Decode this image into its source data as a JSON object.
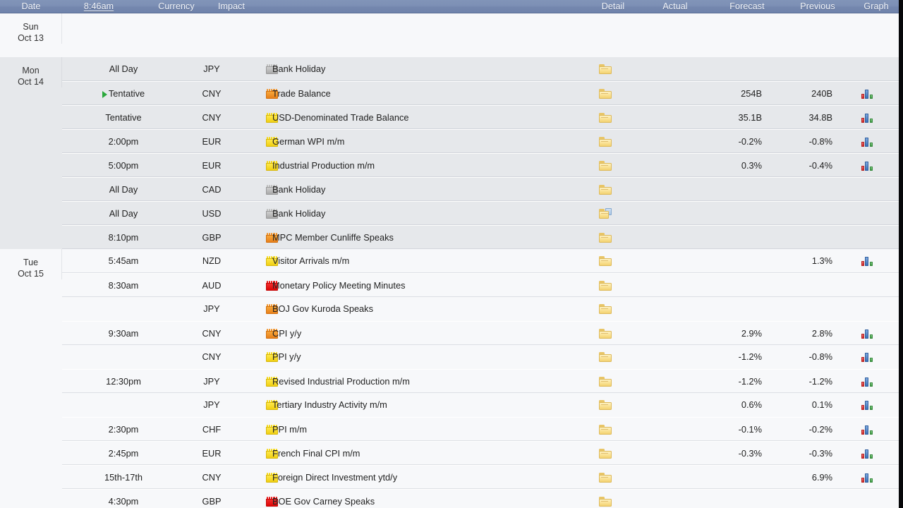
{
  "header": {
    "columns": [
      {
        "key": "date",
        "label": "Date",
        "link": false
      },
      {
        "key": "time",
        "label": "8:46am",
        "link": true
      },
      {
        "key": "currency",
        "label": "Currency",
        "link": false
      },
      {
        "key": "impact",
        "label": "Impact",
        "link": false
      },
      {
        "key": "detail",
        "label": "Detail",
        "link": false
      },
      {
        "key": "actual",
        "label": "Actual",
        "link": false
      },
      {
        "key": "forecast",
        "label": "Forecast",
        "link": false
      },
      {
        "key": "previous",
        "label": "Previous",
        "link": false
      },
      {
        "key": "graph",
        "label": "Graph",
        "link": false
      }
    ]
  },
  "colors": {
    "header_bar": "#7a8cb2",
    "row_shade": "#e6e8eb",
    "row_light": "#f7f8fa",
    "impact_holiday": "#b5b5b5",
    "impact_low": "#f2d419",
    "impact_medium": "#ee8a1f",
    "impact_high": "#e00a0a",
    "tentative_marker": "#2aa83c",
    "graph_bar_red": "#cf2a2a",
    "graph_bar_blue": "#3a6fb5",
    "graph_bar_green": "#3f9b45"
  },
  "days": [
    {
      "weekday": "Sun",
      "date": "Oct 13",
      "shaded": false,
      "events": []
    },
    {
      "weekday": "Mon",
      "date": "Oct 14",
      "shaded": true,
      "events": [
        {
          "time": "All Day",
          "tentative": false,
          "currency": "JPY",
          "impact": "holiday",
          "event": "Bank Holiday",
          "detail": "folder",
          "actual": "",
          "forecast": "",
          "previous": "",
          "graph": false
        },
        {
          "time": "Tentative",
          "tentative": true,
          "currency": "CNY",
          "impact": "medium",
          "event": "Trade Balance",
          "detail": "folder",
          "actual": "",
          "forecast": "254B",
          "previous": "240B",
          "graph": true
        },
        {
          "time": "Tentative",
          "tentative": false,
          "currency": "CNY",
          "impact": "low",
          "event": "USD-Denominated Trade Balance",
          "detail": "folder",
          "actual": "",
          "forecast": "35.1B",
          "previous": "34.8B",
          "graph": true
        },
        {
          "time": "2:00pm",
          "tentative": false,
          "currency": "EUR",
          "impact": "low",
          "event": "German WPI m/m",
          "detail": "folder",
          "actual": "",
          "forecast": "-0.2%",
          "previous": "-0.8%",
          "graph": true
        },
        {
          "time": "5:00pm",
          "tentative": false,
          "currency": "EUR",
          "impact": "low",
          "event": "Industrial Production m/m",
          "detail": "folder",
          "actual": "",
          "forecast": "0.3%",
          "previous": "-0.4%",
          "graph": true
        },
        {
          "time": "All Day",
          "tentative": false,
          "currency": "CAD",
          "impact": "holiday",
          "event": "Bank Holiday",
          "detail": "folder",
          "actual": "",
          "forecast": "",
          "previous": "",
          "graph": false
        },
        {
          "time": "All Day",
          "tentative": false,
          "currency": "USD",
          "impact": "holiday",
          "event": "Bank Holiday",
          "detail": "folder-open",
          "actual": "",
          "forecast": "",
          "previous": "",
          "graph": false
        },
        {
          "time": "8:10pm",
          "tentative": false,
          "currency": "GBP",
          "impact": "medium",
          "event": "MPC Member Cunliffe Speaks",
          "detail": "folder",
          "actual": "",
          "forecast": "",
          "previous": "",
          "graph": false
        }
      ]
    },
    {
      "weekday": "Tue",
      "date": "Oct 15",
      "shaded": false,
      "events": [
        {
          "time": "5:45am",
          "tentative": false,
          "currency": "NZD",
          "impact": "low",
          "event": "Visitor Arrivals m/m",
          "detail": "folder",
          "actual": "",
          "forecast": "",
          "previous": "1.3%",
          "graph": true
        },
        {
          "time": "8:30am",
          "tentative": false,
          "currency": "AUD",
          "impact": "high",
          "event": "Monetary Policy Meeting Minutes",
          "detail": "folder",
          "actual": "",
          "forecast": "",
          "previous": "",
          "graph": false
        },
        {
          "time": "",
          "tentative": false,
          "currency": "JPY",
          "impact": "medium",
          "event": "BOJ Gov Kuroda Speaks",
          "detail": "folder",
          "actual": "",
          "forecast": "",
          "previous": "",
          "graph": false
        },
        {
          "time": "9:30am",
          "tentative": false,
          "currency": "CNY",
          "impact": "medium",
          "event": "CPI y/y",
          "detail": "folder",
          "actual": "",
          "forecast": "2.9%",
          "previous": "2.8%",
          "graph": true
        },
        {
          "time": "",
          "tentative": false,
          "currency": "CNY",
          "impact": "low",
          "event": "PPI y/y",
          "detail": "folder",
          "actual": "",
          "forecast": "-1.2%",
          "previous": "-0.8%",
          "graph": true
        },
        {
          "time": "12:30pm",
          "tentative": false,
          "currency": "JPY",
          "impact": "low",
          "event": "Revised Industrial Production m/m",
          "detail": "folder",
          "actual": "",
          "forecast": "-1.2%",
          "previous": "-1.2%",
          "graph": true
        },
        {
          "time": "",
          "tentative": false,
          "currency": "JPY",
          "impact": "low",
          "event": "Tertiary Industry Activity m/m",
          "detail": "folder",
          "actual": "",
          "forecast": "0.6%",
          "previous": "0.1%",
          "graph": true
        },
        {
          "time": "2:30pm",
          "tentative": false,
          "currency": "CHF",
          "impact": "low",
          "event": "PPI m/m",
          "detail": "folder",
          "actual": "",
          "forecast": "-0.1%",
          "previous": "-0.2%",
          "graph": true
        },
        {
          "time": "2:45pm",
          "tentative": false,
          "currency": "EUR",
          "impact": "low",
          "event": "French Final CPI m/m",
          "detail": "folder",
          "actual": "",
          "forecast": "-0.3%",
          "previous": "-0.3%",
          "graph": true
        },
        {
          "time": "15th-17th",
          "tentative": false,
          "currency": "CNY",
          "impact": "low",
          "event": "Foreign Direct Investment ytd/y",
          "detail": "folder",
          "actual": "",
          "forecast": "",
          "previous": "6.9%",
          "graph": true
        },
        {
          "time": "4:30pm",
          "tentative": false,
          "currency": "GBP",
          "impact": "high",
          "event": "BOE Gov Carney Speaks",
          "detail": "folder",
          "actual": "",
          "forecast": "",
          "previous": "",
          "graph": false
        }
      ]
    }
  ]
}
